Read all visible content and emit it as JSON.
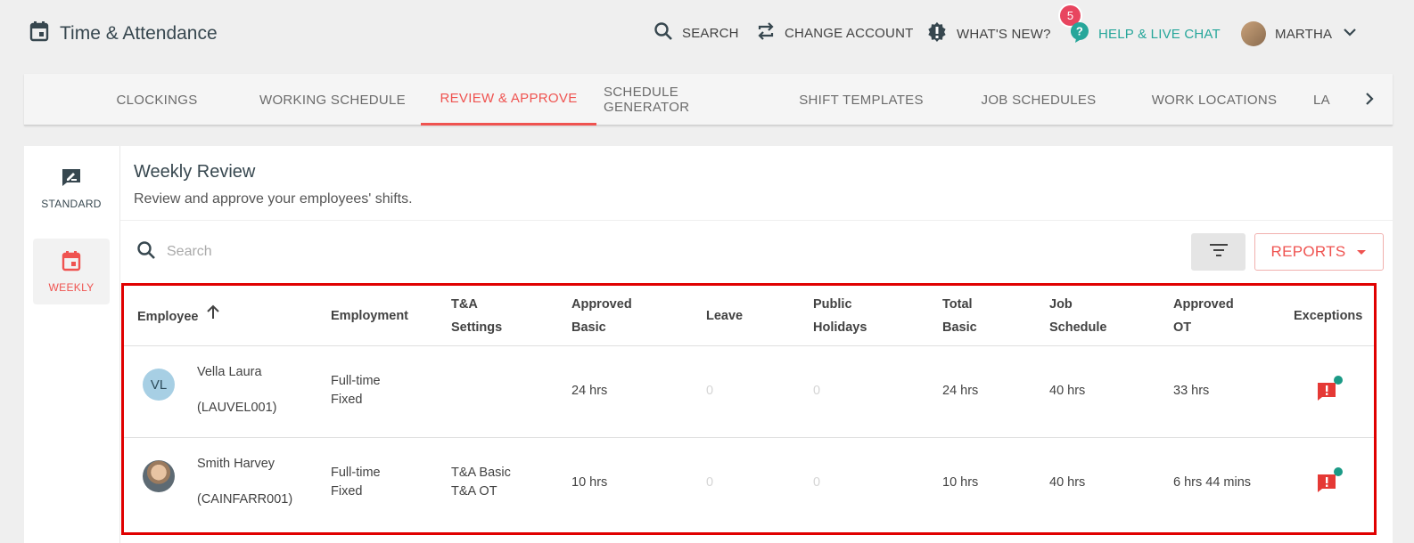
{
  "app": {
    "title": "Time & Attendance"
  },
  "topnav": {
    "search": "SEARCH",
    "change_account": "CHANGE ACCOUNT",
    "whats_new": "WHAT'S NEW?",
    "whats_new_badge": "5",
    "help": "HELP & LIVE CHAT",
    "user": "MARTHA"
  },
  "tabs": [
    "CLOCKINGS",
    "WORKING SCHEDULE",
    "REVIEW & APPROVE",
    "SCHEDULE GENERATOR",
    "SHIFT TEMPLATES",
    "JOB SCHEDULES",
    "WORK LOCATIONS",
    "LA"
  ],
  "active_tab": "REVIEW & APPROVE",
  "sidebar": {
    "standard": "STANDARD",
    "weekly": "WEEKLY"
  },
  "page": {
    "title": "Weekly Review",
    "subtitle": "Review and approve your employees' shifts."
  },
  "search": {
    "placeholder": "Search"
  },
  "reports": {
    "label": "REPORTS"
  },
  "table": {
    "headers": {
      "employee": "Employee",
      "employment": "Employment",
      "ta_settings_1": "T&A",
      "ta_settings_2": "Settings",
      "approved_basic_1": "Approved",
      "approved_basic_2": "Basic",
      "leave": "Leave",
      "public_holidays_1": "Public",
      "public_holidays_2": "Holidays",
      "total_basic_1": "Total",
      "total_basic_2": "Basic",
      "job_schedule_1": "Job",
      "job_schedule_2": "Schedule",
      "approved_ot_1": "Approved",
      "approved_ot_2": "OT",
      "exceptions": "Exceptions"
    },
    "rows": [
      {
        "initials": "VL",
        "name": "Vella Laura",
        "code": "(LAUVEL001)",
        "employment_1": "Full-time",
        "employment_2": "Fixed",
        "ta_1": "",
        "ta_2": "",
        "approved_basic": "24 hrs",
        "leave": "0",
        "public_holidays": "0",
        "total_basic": "24 hrs",
        "job_schedule": "40 hrs",
        "approved_ot": "33 hrs"
      },
      {
        "initials": "",
        "name": "Smith Harvey",
        "code": "(CAINFARR001)",
        "employment_1": "Full-time",
        "employment_2": "Fixed",
        "ta_1": "T&A Basic",
        "ta_2": "T&A OT",
        "approved_basic": "10 hrs",
        "leave": "0",
        "public_holidays": "0",
        "total_basic": "10 hrs",
        "job_schedule": "40 hrs",
        "approved_ot": "6 hrs 44 mins"
      }
    ]
  },
  "colors": {
    "accent": "#ef5350",
    "help": "#26a69a",
    "badge": "#e8455f",
    "exception_dot": "#1b9a86",
    "highlight_border": "#e00000"
  }
}
